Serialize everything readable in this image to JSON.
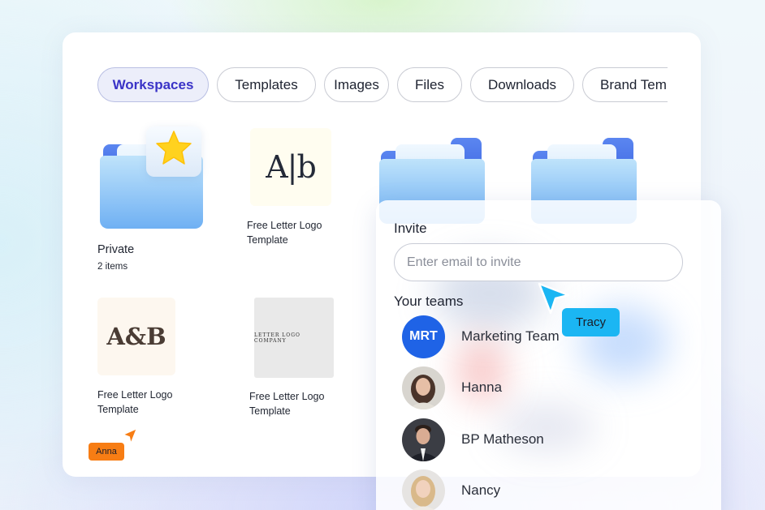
{
  "tabs": [
    "Workspaces",
    "Templates",
    "Images",
    "Files",
    "Downloads",
    "Brand Templates"
  ],
  "active_tab": "Workspaces",
  "items": {
    "private": {
      "title": "Private",
      "subtitle": "2 items"
    },
    "template1": {
      "title_line1": "Free Letter Logo",
      "title_line2": "Template",
      "thumb_text": "A|b"
    },
    "template2": {
      "title_line1": "Free Letter Logo",
      "title_line2": "Template",
      "thumb_text": "A&B"
    },
    "template3": {
      "title_line1": "Free Letter Logo",
      "title_line2": "Template",
      "thumb_text": "LETTER LOGO COMPANY"
    }
  },
  "cursors": {
    "anna": {
      "name": "Anna",
      "color": "#f77d14"
    },
    "tracy": {
      "name": "Tracy",
      "color": "#1bb6f3"
    }
  },
  "invite": {
    "title": "Invite",
    "email_placeholder": "Enter email to invite",
    "teams_title": "Your teams",
    "members": [
      {
        "initials": "MRT",
        "name": "Marketing Team",
        "avatar_color": "#1f63e6"
      },
      {
        "name": "Hanna"
      },
      {
        "name": "BP Matheson"
      },
      {
        "name": "Nancy"
      }
    ]
  },
  "icons": {
    "favorite": "star-icon",
    "cursor": "pointer-arrow-icon"
  },
  "colors": {
    "accent": "#3a33c7",
    "folder": "#6fb0f3",
    "star": "#ffd21f"
  }
}
